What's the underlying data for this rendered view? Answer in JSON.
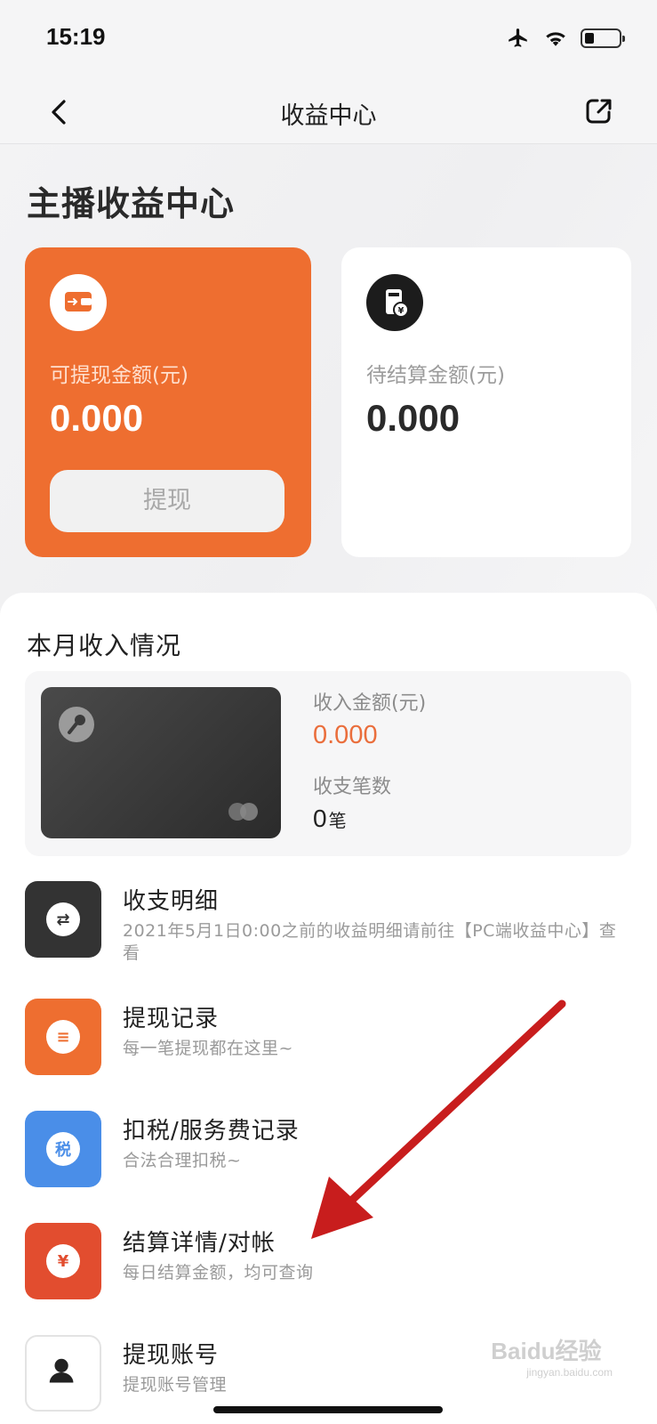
{
  "status_bar": {
    "time": "15:19"
  },
  "nav": {
    "title": "收益中心"
  },
  "hero": {
    "title": "主播收益中心",
    "withdrawable": {
      "label": "可提现金额(元)",
      "value": "0.000",
      "button": "提现"
    },
    "pending": {
      "label": "待结算金额(元)",
      "value": "0.000",
      "icon_text": "¥"
    }
  },
  "month": {
    "title": "本月收入情况",
    "income_label": "收入金额(元)",
    "income_value": "0.000",
    "count_label": "收支笔数",
    "count_value": "0",
    "count_unit": "笔"
  },
  "menu": [
    {
      "title": "收支明细",
      "subtitle": "2021年5月1日0:00之前的收益明细请前往【PC端收益中心】查看",
      "color": "#333333",
      "icon": "exchange-icon",
      "glyph": "⇄"
    },
    {
      "title": "提现记录",
      "subtitle": "每一笔提现都在这里~",
      "color": "#ee6e30",
      "icon": "record-icon",
      "glyph": "≡"
    },
    {
      "title": "扣税/服务费记录",
      "subtitle": "合法合理扣税~",
      "color": "#4a8ee8",
      "icon": "tax-icon",
      "glyph": "税"
    },
    {
      "title": "结算详情/对帐",
      "subtitle": "每日结算金额，均可查询",
      "color": "#e24d2f",
      "icon": "yen-icon",
      "glyph": "¥"
    },
    {
      "title": "提现账号",
      "subtitle": "提现账号管理",
      "color": "#ffffff",
      "icon": "user-icon",
      "glyph": ""
    }
  ],
  "watermark": {
    "brand": "Baidu经验",
    "url": "jingyan.baidu.com"
  }
}
